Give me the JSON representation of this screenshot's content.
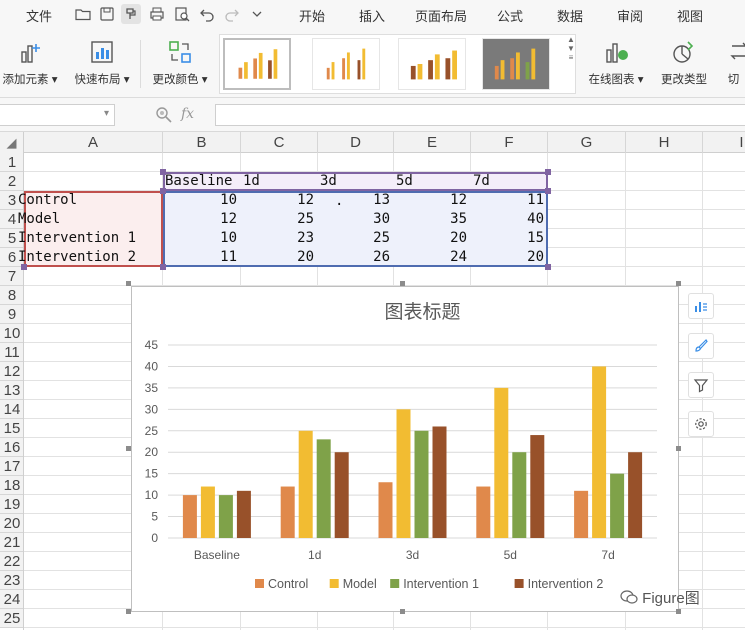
{
  "menubar": {
    "file": "文件",
    "menus": [
      "开始",
      "插入",
      "页面布局",
      "公式",
      "数据",
      "审阅",
      "视图"
    ]
  },
  "ribbon": {
    "add_element": "添加元素",
    "quick_layout": "快速布局",
    "change_color": "更改颜色",
    "online_chart": "在线图表",
    "change_type": "更改类型",
    "switch": "切"
  },
  "formula_bar": {
    "fx": "fx",
    "cell_ref": "",
    "value": ""
  },
  "columns": [
    "A",
    "B",
    "C",
    "D",
    "E",
    "F",
    "G",
    "H",
    "I"
  ],
  "rows": [
    "1",
    "2",
    "3",
    "4",
    "5",
    "6",
    "7",
    "8",
    "9",
    "10",
    "11",
    "12",
    "13",
    "14",
    "15",
    "16",
    "17",
    "18",
    "19",
    "20",
    "21",
    "22",
    "23",
    "24",
    "25"
  ],
  "table": {
    "headers": [
      "Baseline",
      "1d",
      "3d",
      "5d",
      "7d"
    ],
    "data_rows": [
      {
        "label": "Control",
        "values": [
          "10",
          "12",
          "13",
          "12",
          "11"
        ]
      },
      {
        "label": "Model",
        "values": [
          "12",
          "25",
          "30",
          "35",
          "40"
        ]
      },
      {
        "label": "Intervention 1",
        "values": [
          "10",
          "23",
          "25",
          "20",
          "15"
        ]
      },
      {
        "label": "Intervention 2",
        "values": [
          "11",
          "20",
          "26",
          "24",
          "20"
        ]
      }
    ],
    "stray_mark": "."
  },
  "chart_data": {
    "type": "bar",
    "title": "图表标题",
    "categories": [
      "Baseline",
      "1d",
      "3d",
      "5d",
      "7d"
    ],
    "series": [
      {
        "name": "Control",
        "values": [
          10,
          12,
          13,
          12,
          11
        ],
        "color": "#e0894b"
      },
      {
        "name": "Model",
        "values": [
          12,
          25,
          30,
          35,
          40
        ],
        "color": "#f2bc32"
      },
      {
        "name": "Intervention 1",
        "values": [
          10,
          23,
          25,
          20,
          15
        ],
        "color": "#7fa249"
      },
      {
        "name": "Intervention 2",
        "values": [
          11,
          20,
          26,
          24,
          20
        ],
        "color": "#98512a"
      }
    ],
    "yticks": [
      "0",
      "5",
      "10",
      "15",
      "20",
      "25",
      "30",
      "35",
      "40",
      "45"
    ],
    "ylim": [
      0,
      45
    ],
    "grid": true,
    "legend": "bottom"
  },
  "watermark": "Figure图",
  "colors": {
    "label_fill": "#fbeeee",
    "label_border": "#c0504d",
    "value_fill": "#eef1fb",
    "value_border": "#4f6cb0",
    "header_fill": "#f4eef9",
    "header_border": "#8064a2"
  }
}
